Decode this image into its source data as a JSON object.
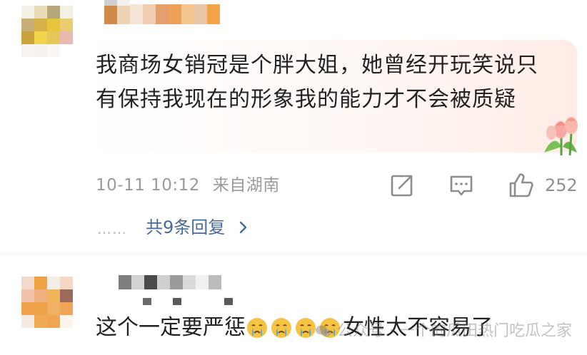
{
  "comment1": {
    "text": "我商场女销冠是个胖大姐，她曾经开玩笑说只有保持我现在的形象我的能力才不会被质疑",
    "time": "10-11 10:12",
    "location": "来自湖南",
    "like_count": "252",
    "replies_label": "共9条回复",
    "dots": "……",
    "colors": {
      "text": "#222222",
      "meta": "#9a9a9a",
      "link": "#456a9c"
    }
  },
  "comment2": {
    "text_before": "这个一定要严惩",
    "text_after": "女性太不容易了"
  },
  "watermark": {
    "text": "公众号 · 一个的瓜田热门吃瓜之家"
  },
  "icons": {
    "share": "share-icon",
    "comment": "comment-icon",
    "like": "thumbs-up-icon",
    "reply_chevron": "chevron-right-icon",
    "cry": "crying-face-icon",
    "sticker": "tulip-sticker-icon"
  }
}
